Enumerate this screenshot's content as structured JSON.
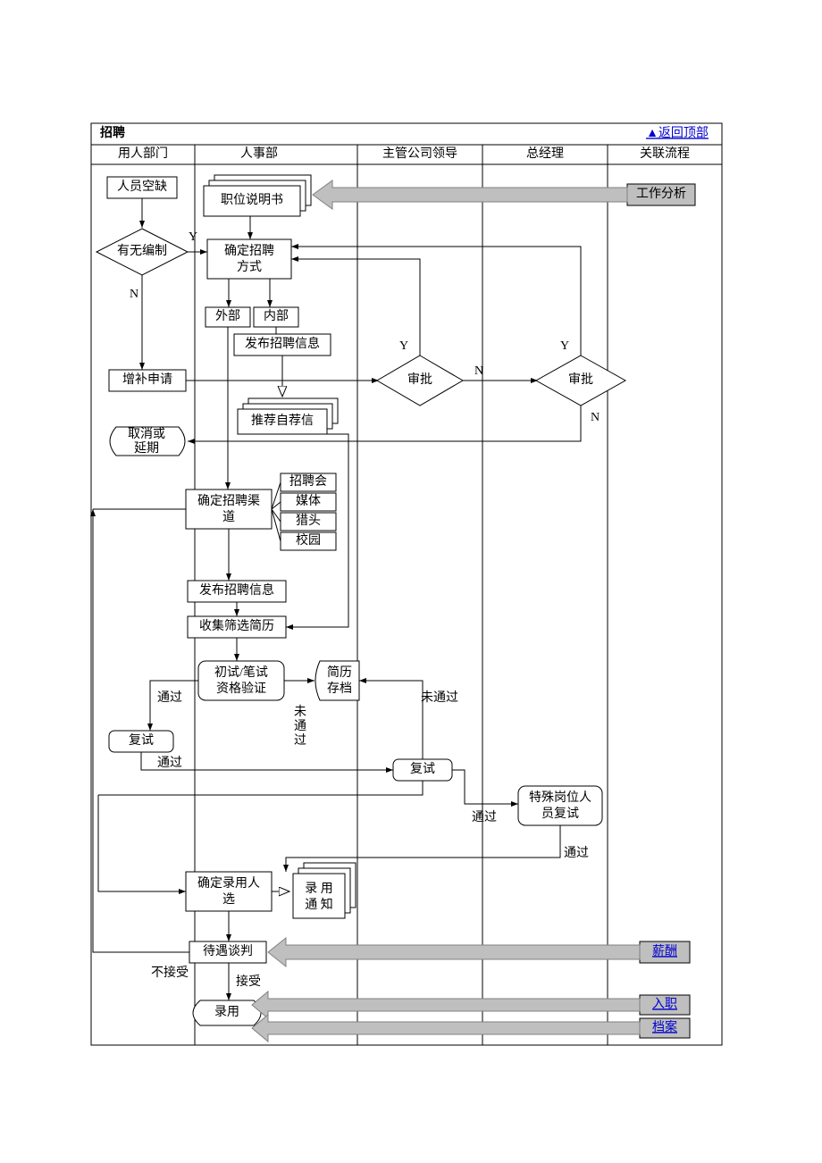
{
  "header": {
    "title": "招聘",
    "topLink": "▲返回顶部"
  },
  "lanes": {
    "l1": "用人部门",
    "l2": "人事部",
    "l3": "主管公司领导",
    "l4": "总经理",
    "l5": "关联流程"
  },
  "labels": {
    "vacancy": "人员空缺",
    "jobDesc": "职位说明书",
    "hasQuota": "有无编制",
    "hireMethod": "确定招聘\n方式",
    "external": "外部",
    "internal": "内部",
    "publish": "发布招聘信息",
    "supplement": "增补申请",
    "approve": "审批",
    "cancel": "取消或\n延期",
    "recommend": "推荐自荐信",
    "channel": "确定招聘渠\n道",
    "ch1": "招聘会",
    "ch2": "媒体",
    "ch3": "猎头",
    "ch4": "校园",
    "publish2": "发布招聘信息",
    "collect": "收集筛选简历",
    "firstTest": "初试/笔试\n资格验证",
    "archive": "简历\n存档",
    "pass": "通过",
    "notPass": "未通过",
    "notPassV": "未\n通\n过",
    "retest": "复试",
    "specialTest": "特殊岗位人\n员复试",
    "finalSel": "确定录用人\n选",
    "offer": "录 用\n通 知",
    "negotiate": "待遇谈判",
    "notAccept": "不接受",
    "accept": "接受",
    "hire": "录用",
    "rel1": "工作分析",
    "rel2": "薪酬",
    "rel3": "入职",
    "rel4": "档案"
  },
  "yn": {
    "Y": "Y",
    "N": "N"
  }
}
